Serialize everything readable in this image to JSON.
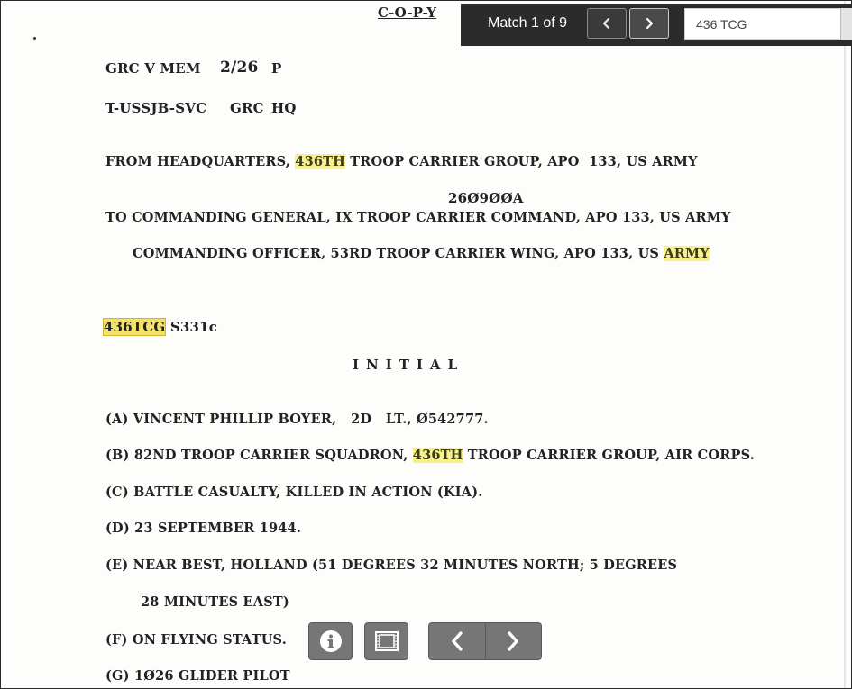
{
  "search": {
    "match_status": "Match 1 of 9",
    "query": "436 TCG",
    "prev_icon": "chevron-left-icon",
    "next_icon": "chevron-right-icon"
  },
  "document": {
    "title": "C-O-P-Y",
    "ref_line_1": {
      "a": "GRC V MEM",
      "b": "2/26",
      "c": "P"
    },
    "ref_line_2": {
      "a": "T-USSJB-SVC",
      "b": "GRC",
      "c": "HQ"
    },
    "from_line": {
      "prefix": "FROM HEADQUARTERS, ",
      "match": "436TH",
      "suffix": " TROOP CARRIER GROUP, APO  133, US ARMY"
    },
    "dtg": "26Ø9ØØA",
    "to_line": "TO COMMANDING GENERAL, IX TROOP CARRIER COMMAND, APO 133, US ARMY",
    "cc_line": {
      "prefix": "COMMANDING OFFICER, 53RD TROOP CARRIER WING, APO 133, US ",
      "match": "ARMY"
    },
    "ref_code": {
      "match": "436TCG",
      "suffix": " S331c"
    },
    "heading": "INITIAL",
    "items": {
      "a": "(A) VINCENT PHILLIP BOYER,   2D   LT., Ø542777.",
      "b": {
        "prefix": "(B) 82ND TROOP CARRIER SQUADRON, ",
        "match": "436TH",
        "suffix": " TROOP CARRIER GROUP, AIR CORPS."
      },
      "c": "(C) BATTLE CASUALTY, KILLED IN ACTION (KIA).",
      "d": "(D) 23 SEPTEMBER 1944.",
      "e1": "(E) NEAR BEST, HOLLAND (51 DEGREES 32 MINUTES NORTH; 5 DEGREES",
      "e2": "28 MINUTES EAST)",
      "f": "(F) ON FLYING STATUS.",
      "g": "(G) 1Ø26 GLIDER PILOT"
    }
  },
  "toolbar": {
    "info_icon": "info-icon",
    "filmstrip_icon": "filmstrip-icon",
    "prev_page_icon": "chevron-left-icon",
    "next_page_icon": "chevron-right-icon"
  }
}
